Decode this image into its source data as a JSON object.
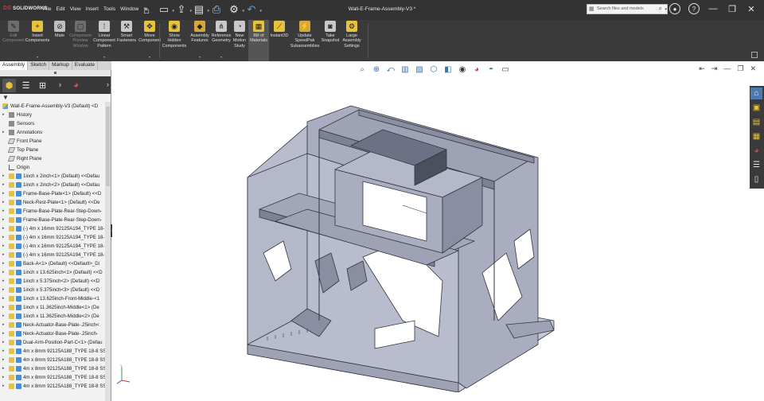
{
  "app": {
    "logo_brand": "DS",
    "logo_text": "SOLIDWORKS",
    "document_title": "Wall-E-Frame-Assembly-V3 *"
  },
  "menu": [
    "File",
    "Edit",
    "View",
    "Insert",
    "Tools",
    "Window"
  ],
  "pin_icon": "pin-icon",
  "quick_access": [
    {
      "name": "home-icon",
      "glyph": "⌂"
    },
    {
      "name": "new-document-icon",
      "glyph": "▭"
    },
    {
      "name": "open-icon",
      "glyph": "⇪"
    },
    {
      "name": "save-icon",
      "glyph": "▤"
    },
    {
      "name": "print-icon",
      "glyph": "⎙"
    },
    {
      "name": "options-gear-icon",
      "glyph": "⚙"
    },
    {
      "name": "undo-icon",
      "glyph": "↶"
    }
  ],
  "search": {
    "placeholder": "Search files and models"
  },
  "command_manager": [
    {
      "label": "Edit Component",
      "icon_color": "#6d6d6d",
      "glyph": "✎",
      "disabled": true
    },
    {
      "label": "Insert Components",
      "icon_color": "#e7c23c",
      "glyph": "+",
      "disabled": false
    },
    {
      "label": "Mate",
      "icon_color": "#c0c0c0",
      "glyph": "⊘",
      "disabled": false
    },
    {
      "label": "Component Preview Window",
      "icon_color": "#6d6d6d",
      "glyph": "▢",
      "disabled": true
    },
    {
      "label": "Linear Component Pattern",
      "icon_color": "#c9c9c9",
      "glyph": "⁞",
      "disabled": false
    },
    {
      "label": "Smart Fasteners",
      "icon_color": "#c9c9c9",
      "glyph": "⚒",
      "disabled": false
    },
    {
      "label": "Move Component",
      "icon_color": "#e7c23c",
      "glyph": "✥",
      "disabled": false
    },
    {
      "label": "Show Hidden Components",
      "icon_color": "#e7c23c",
      "glyph": "◉",
      "disabled": false
    },
    {
      "label": "Assembly Features",
      "icon_color": "#d6a83c",
      "glyph": "◆",
      "disabled": false
    },
    {
      "label": "Reference Geometry",
      "icon_color": "#c9c9c9",
      "glyph": "⋔",
      "disabled": false
    },
    {
      "label": "New Motion Study",
      "icon_color": "#c9c9c9",
      "glyph": "◔",
      "disabled": false
    },
    {
      "label": "Bill of Materials",
      "icon_color": "#e7c23c",
      "glyph": "▦",
      "disabled": false,
      "active": true
    },
    {
      "label": "Instant3D",
      "icon_color": "#e7c23c",
      "glyph": "⟋",
      "disabled": false
    },
    {
      "label": "Update SpeedPak Subassemblies",
      "icon_color": "#d6a83c",
      "glyph": "⚡",
      "disabled": false
    },
    {
      "label": "Take Snapshot",
      "icon_color": "#c9c9c9",
      "glyph": "◙",
      "disabled": false
    },
    {
      "label": "Large Assembly Settings",
      "icon_color": "#e7c23c",
      "glyph": "⚙",
      "disabled": false
    }
  ],
  "tabs": [
    "Assembly",
    "Sketch",
    "Markup",
    "Evaluate"
  ],
  "tree": {
    "root": "Wall-E-Frame-Assembly-V3 (Default) <D",
    "top_items": [
      "History",
      "Sensors",
      "Annotations",
      "Front Plane",
      "Top Plane",
      "Right Plane",
      "Origin"
    ],
    "components": [
      "1inch x 2inch<1> (Default) <<Defau",
      "1inch x 2inch<2> (Default) <<Defau",
      "Frame-Base-Plate<1> (Default) <<D",
      "Neck-Rest-Plate<1> (Default) <<De",
      "Frame-Base-Plate-Rear-Step-Down-",
      "Frame-Base-Plate-Rear-Step-Down-",
      "(-) 4m x 16mm 92125A194_TYPE 18-",
      "(-) 4m x 16mm 92125A194_TYPE 18-",
      "(-) 4m x 16mm 92125A194_TYPE 18-",
      "(-) 4m x 16mm 92125A194_TYPE 18-",
      "Back-A<1> (Default) <<Default>_Di",
      "1inch x 13.625inch<1> (Default) <<D",
      "1inch x 5.375inch<2> (Default) <<D",
      "1inch x 5.375inch<3> (Default) <<D",
      "1inch x 13.625inch-Front-Middle-<1",
      "1inch x 11.3625inch-Middle<1> (De",
      "1inch x 11.3625inch-Middle<2> (De",
      "Neck-Actuator-Base-Plate-.25inch<",
      "Neck-Actuator-Base-Plate-.25inch-",
      "Dual-Arm-Position-Part-C<1> (Defau",
      "4m x 8mm 92125A188_TYPE 18-8 SS",
      "4m x 8mm 92125A188_TYPE 18-8 SS",
      "4m x 8mm 92125A188_TYPE 18-8 SS",
      "4m x 8mm 92125A188_TYPE 18-8 SS",
      "4m x 8mm 92125A188_TYPE 18-8 SS"
    ]
  },
  "viewport": {
    "model_color": "#b4b8c9",
    "model_edge_color": "#33363f"
  }
}
